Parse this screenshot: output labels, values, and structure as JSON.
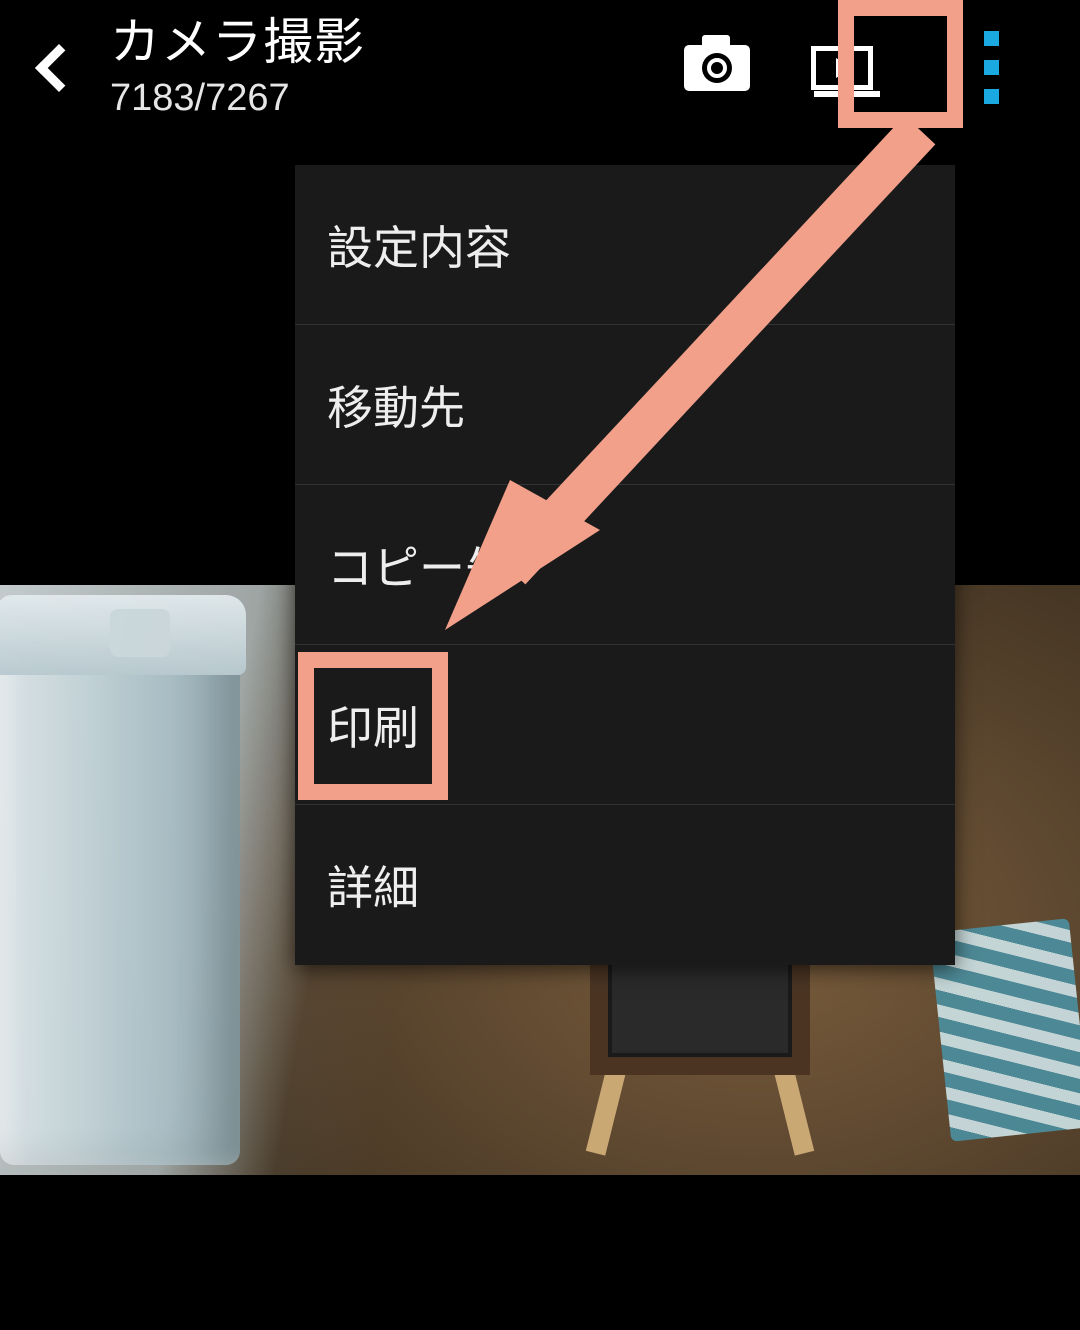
{
  "header": {
    "title": "カメラ撮影",
    "counter": "7183/7267"
  },
  "menu": {
    "items": [
      {
        "label": "設定内容"
      },
      {
        "label": "移動先"
      },
      {
        "label": "コピー先"
      },
      {
        "label": "印刷"
      },
      {
        "label": "詳細"
      }
    ]
  },
  "annotation": {
    "highlight_color": "#f3a08a",
    "overflow_dot_color": "#1aa9e0"
  }
}
